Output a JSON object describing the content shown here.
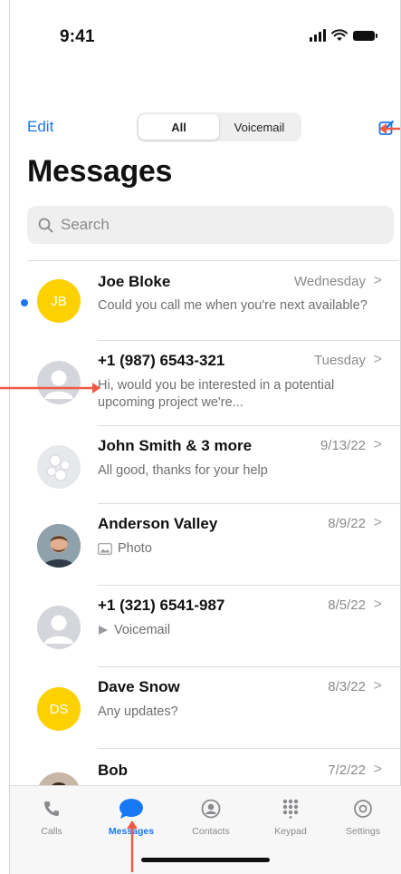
{
  "status": {
    "time": "9:41"
  },
  "nav": {
    "edit_label": "Edit",
    "segments": [
      "All",
      "Voicemail"
    ],
    "active_segment": "All"
  },
  "page_title": "Messages",
  "search": {
    "placeholder": "Search"
  },
  "conversations": [
    {
      "name": "Joe Bloke",
      "date": "Wednesday",
      "preview": "Could you call me when you're next available?",
      "avatar": "initials",
      "initials": "JB",
      "unread": true
    },
    {
      "name": "+1 (987) 6543-321",
      "date": "Tuesday",
      "preview": "Hi, would you be interested in a potential upcoming project we're...",
      "avatar": "generic",
      "unread": false
    },
    {
      "name": "John Smith & 3 more",
      "date": "9/13/22",
      "preview": "All good, thanks for your help",
      "avatar": "group",
      "unread": false
    },
    {
      "name": "Anderson Valley",
      "date": "8/9/22",
      "preview": "Photo",
      "preview_icon": "photo-icon",
      "avatar": "photo",
      "unread": false
    },
    {
      "name": "+1 (321) 6541-987",
      "date": "8/5/22",
      "preview": "Voicemail",
      "preview_icon": "play-icon",
      "avatar": "generic",
      "unread": false
    },
    {
      "name": "Dave Snow",
      "date": "8/3/22",
      "preview": "Any updates?",
      "avatar": "initials",
      "initials": "DS",
      "unread": false
    },
    {
      "name": "Bob",
      "date": "7/2/22",
      "preview": "",
      "avatar": "photo",
      "unread": false
    }
  ],
  "tabs": [
    {
      "label": "Calls",
      "icon": "phone-icon"
    },
    {
      "label": "Messages",
      "icon": "chat-bubble-icon",
      "active": true
    },
    {
      "label": "Contacts",
      "icon": "person-circle-icon"
    },
    {
      "label": "Keypad",
      "icon": "keypad-icon"
    },
    {
      "label": "Settings",
      "icon": "gear-icon"
    }
  ],
  "colors": {
    "accent": "#1877f2",
    "avatar_yellow": "#fdd000",
    "annotation": "#ef5a45"
  }
}
